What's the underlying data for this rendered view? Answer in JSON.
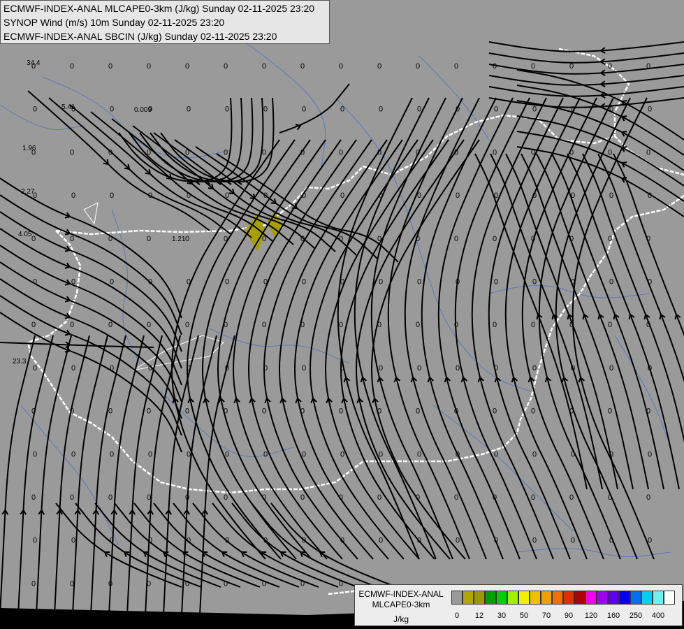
{
  "header": {
    "line1": "ECMWF-INDEX-ANAL MLCAPE0-3km (J/kg) Sunday 02-11-2025 23:20",
    "line2": "SYNOP Wind (m/s) 10m Sunday 02-11-2025 23:20",
    "line3": "ECMWF-INDEX-ANAL SBCIN (J/kg) Sunday 02-11-2025 23:20"
  },
  "legend": {
    "name_line1": "ECMWF-INDEX-ANAL",
    "name_line2": "MLCAPE0-3km",
    "unit": "J/kg",
    "colors": [
      "#9a9a9a",
      "#b0a800",
      "#9a9a00",
      "#00a000",
      "#00d000",
      "#a0f000",
      "#f0f000",
      "#f0c000",
      "#f0a000",
      "#f07000",
      "#e03000",
      "#b00000",
      "#f000f0",
      "#a000f0",
      "#6000f0",
      "#0000f0",
      "#0070f0",
      "#00d0f0",
      "#70f0f0",
      "#ffffff"
    ],
    "labels": [
      "0",
      "12",
      "30",
      "50",
      "70",
      "90",
      "120",
      "160",
      "250",
      "400"
    ]
  },
  "map": {
    "background": "#9a9a9a",
    "border_color": "#ffffff",
    "river_color": "#5a7ab8",
    "streamline_color": "#000000",
    "cape_patch_color": "#a8a000",
    "cin_values": [
      {
        "v": "34.4"
      },
      {
        "v": "5.41"
      },
      {
        "v": "0.009"
      },
      {
        "v": "1.96"
      },
      {
        "v": "2.27"
      },
      {
        "v": "4.05"
      },
      {
        "v": "1.21"
      },
      {
        "v": "23.3"
      }
    ]
  }
}
